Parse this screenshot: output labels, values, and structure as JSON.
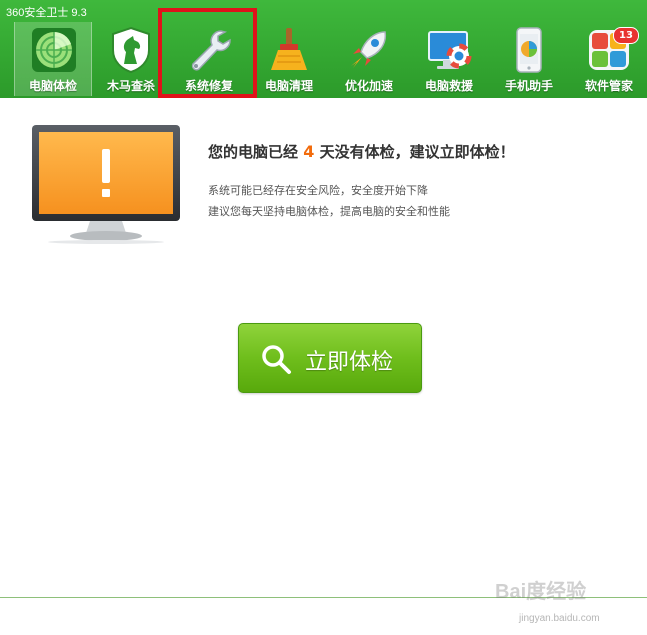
{
  "window": {
    "title": "360安全卫士 9.3"
  },
  "toolbar": {
    "items": [
      {
        "label": "电脑体检",
        "icon": "radar-icon"
      },
      {
        "label": "木马查杀",
        "icon": "horse-shield-icon"
      },
      {
        "label": "系统修复",
        "icon": "wrench-icon"
      },
      {
        "label": "电脑清理",
        "icon": "broom-icon"
      },
      {
        "label": "优化加速",
        "icon": "rocket-icon"
      },
      {
        "label": "电脑救援",
        "icon": "lifebuoy-monitor-icon"
      },
      {
        "label": "手机助手",
        "icon": "phone-icon"
      },
      {
        "label": "软件管家",
        "icon": "apps-icon",
        "badge": "13"
      }
    ],
    "active_index": 0,
    "highlighted_index": 2
  },
  "status": {
    "headline_prefix": "您的电脑已经",
    "days": "4",
    "headline_suffix": "天没有体检，建议立即体检！",
    "line1": "系统可能已经存在安全风险，安全度开始下降",
    "line2": "建议您每天坚持电脑体检，提高电脑的安全和性能"
  },
  "scan_button": {
    "label": "立即体检",
    "icon": "search-icon"
  },
  "watermark": {
    "logo": "Bai度经验",
    "url": "jingyan.baidu.com"
  },
  "colors": {
    "header_green": "#34a832",
    "highlight_red": "#e0121a",
    "days_orange": "#f26b0c",
    "button_green": "#6fbe1c"
  }
}
